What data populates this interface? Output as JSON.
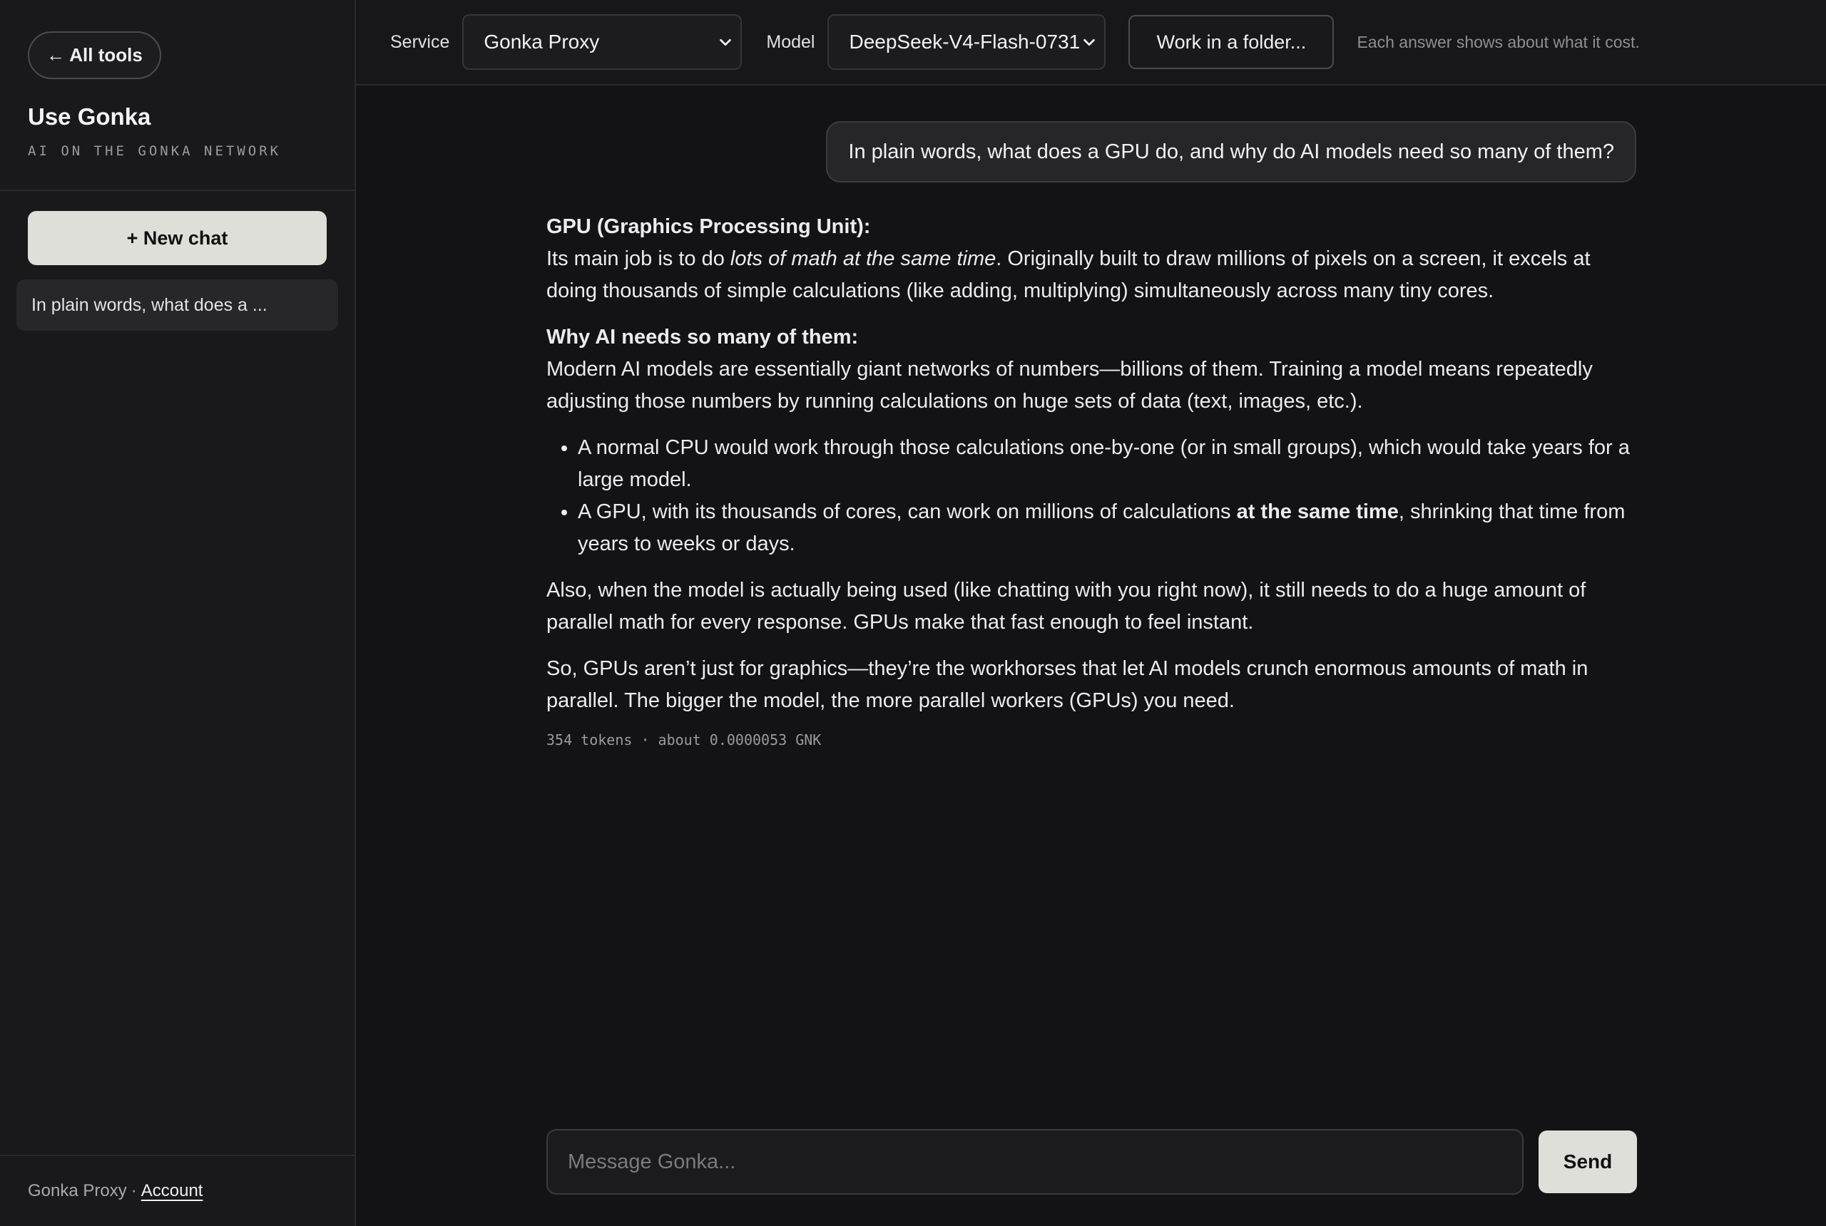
{
  "sidebar": {
    "back_label": "← All tools",
    "brand_title": "Use Gonka",
    "brand_subtitle": "AI ON THE GONKA NETWORK",
    "new_chat_label": "+ New chat",
    "chats": [
      {
        "title": "In plain words, what does a ..."
      }
    ],
    "footer_service": "Gonka Proxy",
    "footer_sep": "·",
    "footer_account": "Account"
  },
  "topbar": {
    "service_label": "Service",
    "service_value": "Gonka Proxy",
    "model_label": "Model",
    "model_value": "DeepSeek-V4-Flash-0731",
    "folder_button": "Work in a folder...",
    "cost_note": "Each answer shows about what it cost."
  },
  "conversation": {
    "user_message": "In plain words, what does a GPU do, and why do AI models need so many of them?",
    "answer": {
      "h1": "GPU (Graphics Processing Unit):",
      "p1_a": "Its main job is to do ",
      "p1_em": "lots of math at the same time",
      "p1_b": ". Originally built to draw millions of pixels on a screen, it excels at doing thousands of simple calculations (like adding, multiplying) simultaneously across many tiny cores.",
      "h2": "Why AI needs so many of them:",
      "p2": "Modern AI models are essentially giant networks of numbers—billions of them. Training a model means repeatedly adjusting those numbers by running calculations on huge sets of data (text, images, etc.).",
      "li1": "A normal CPU would work through those calculations one-by-one (or in small groups), which would take years for a large model.",
      "li2_a": "A GPU, with its thousands of cores, can work on millions of calculations ",
      "li2_strong": "at the same time",
      "li2_b": ", shrinking that time from years to weeks or days.",
      "p3": "Also, when the model is actually being used (like chatting with you right now), it still needs to do a huge amount of parallel math for every response. GPUs make that fast enough to feel instant.",
      "p4": "So, GPUs aren’t just for graphics—they’re the workhorses that let AI models crunch enormous amounts of math in parallel. The bigger the model, the more parallel workers (GPUs) you need."
    },
    "tokens_note": "354 tokens · about 0.0000053 GNK"
  },
  "composer": {
    "placeholder": "Message Gonka...",
    "value": "",
    "send_label": "Send"
  },
  "icons": {
    "select_chevron": "chevron-down-icon"
  }
}
